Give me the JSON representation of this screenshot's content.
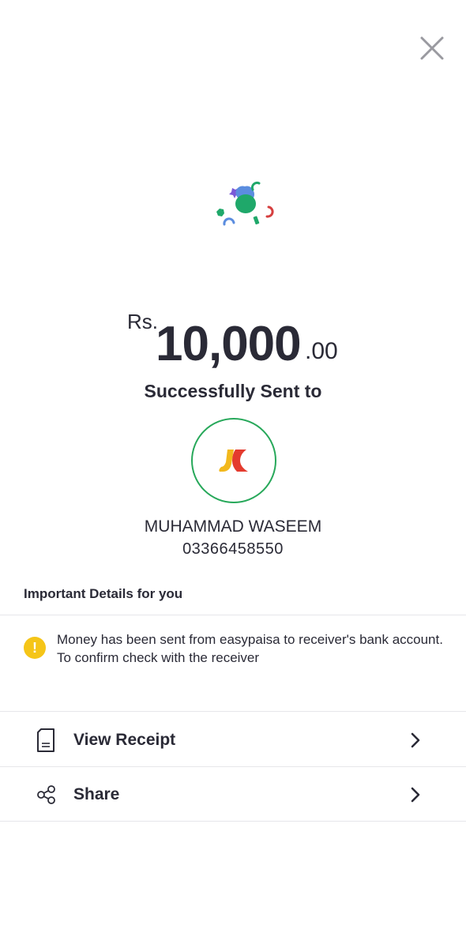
{
  "header": {
    "close_icon": "close-icon"
  },
  "amount": {
    "currency": "Rs.",
    "value": "10,000",
    "decimals": ".00"
  },
  "status_text": "Successfully Sent to",
  "receiver": {
    "name": "MUHAMMAD WASEEM",
    "phone": "03366458550",
    "logo_icon": "bank-logo-icon"
  },
  "details": {
    "title": "Important Details for you",
    "notice_icon": "warning-icon",
    "notice": "Money has been sent from easypaisa to receiver's bank account. To confirm check with the receiver"
  },
  "actions": [
    {
      "label": "View Receipt",
      "icon": "receipt-icon"
    },
    {
      "label": "Share",
      "icon": "share-icon"
    }
  ],
  "colors": {
    "accent_green": "#27a85a",
    "warning_yellow": "#f5c518",
    "text": "#2a2a36"
  }
}
